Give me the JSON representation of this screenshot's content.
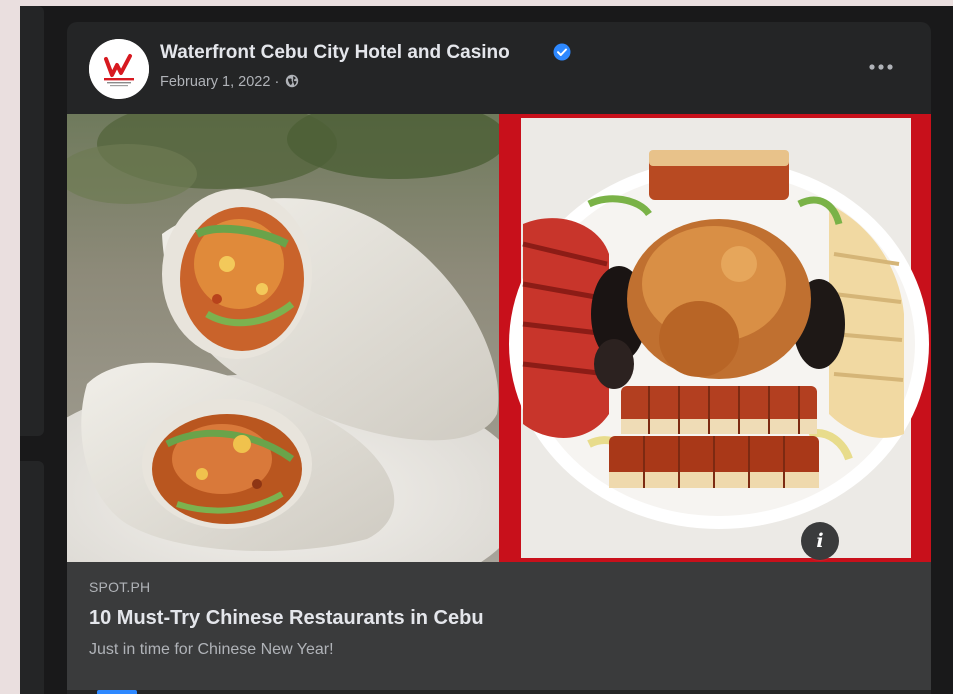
{
  "post": {
    "author": "Waterfront Cebu City Hotel and Casino",
    "date": "February 1, 2022",
    "separator": "·",
    "privacy_icon": "globe-icon",
    "verified_icon": "verified-badge-icon",
    "menu_icon": "more-options-icon",
    "menu_glyph": "•••"
  },
  "link": {
    "domain": "SPOT.PH",
    "title": "10 Must-Try Chinese Restaurants in Cebu",
    "subtitle": "Just in time for Chinese New Year!",
    "info_glyph": "i",
    "info_icon": "info-icon"
  },
  "colors": {
    "card_bg": "#242526",
    "preview_bg": "#3a3b3c",
    "primary_text": "#e4e6eb",
    "secondary_text": "#b0b3b8",
    "verified_blue": "#2d88ff",
    "photo_frame_red": "#c8101b",
    "logo_red": "#d71920"
  }
}
